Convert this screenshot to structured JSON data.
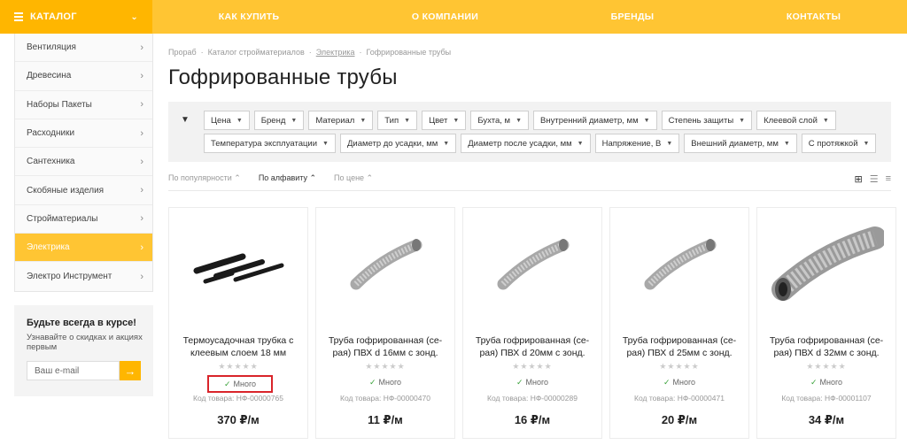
{
  "topbar": {
    "catalog_label": "КАТАЛОГ",
    "nav": [
      "КАК КУПИТЬ",
      "О КОМПАНИИ",
      "БРЕНДЫ",
      "КОНТАКТЫ"
    ]
  },
  "sidebar": {
    "items": [
      {
        "label": "Вентиляция"
      },
      {
        "label": "Древесина"
      },
      {
        "label": "Наборы Пакеты"
      },
      {
        "label": "Расходники"
      },
      {
        "label": "Сантехника"
      },
      {
        "label": "Скобяные изделия"
      },
      {
        "label": "Стройматериалы"
      },
      {
        "label": "Электрика",
        "active": true
      },
      {
        "label": "Электро Инструмент"
      }
    ]
  },
  "subscribe": {
    "title": "Будьте всегда в курсе!",
    "text": "Узнавайте о скидках и акциях первым",
    "placeholder": "Ваш e-mail"
  },
  "breadcrumb": [
    "Прораб",
    "Каталог стройматериалов",
    "Электрика",
    "Гофрированные трубы"
  ],
  "page_title": "Гофрированные трубы",
  "filters": {
    "row1": [
      "Цена",
      "Бренд",
      "Материал",
      "Тип",
      "Цвет",
      "Бухта, м",
      "Внутренний диаметр, мм",
      "Степень защиты",
      "Клеевой слой"
    ],
    "row2": [
      "Температура эксплуатации",
      "Диаметр до усадки, мм",
      "Диаметр после усадки, мм",
      "Напряжение, В",
      "Внешний диаметр, мм",
      "С протяжкой"
    ]
  },
  "sort": {
    "options": [
      "По популярности ⌃",
      "По алфавиту ⌃",
      "По цене ⌃"
    ]
  },
  "products": [
    {
      "name": "Термоусадочная трубка с клеевым слоем 18 мм",
      "stock": "Много",
      "sku": "Код товара: НФ-00000765",
      "price": "370 ₽/м",
      "image": "heat-shrink"
    },
    {
      "name": "Труба гофрированная (се-рая) ПВХ d 16мм с зонд.",
      "stock": "Много",
      "sku": "Код товара: НФ-00000470",
      "price": "11 ₽/м",
      "image": "pipe"
    },
    {
      "name": "Труба гофрированная (се-рая) ПВХ d 20мм с зонд.",
      "stock": "Много",
      "sku": "Код товара: НФ-00000289",
      "price": "16 ₽/м",
      "image": "pipe"
    },
    {
      "name": "Труба гофрированная (се-рая) ПВХ d 25мм с зонд.",
      "stock": "Много",
      "sku": "Код товара: НФ-00000471",
      "price": "20 ₽/м",
      "image": "pipe"
    },
    {
      "name": "Труба гофрированная (се-рая) ПВХ d 32мм с зонд.",
      "stock": "Много",
      "sku": "Код товара: НФ-00001107",
      "price": "34 ₽/м",
      "image": "pipe-large"
    }
  ]
}
